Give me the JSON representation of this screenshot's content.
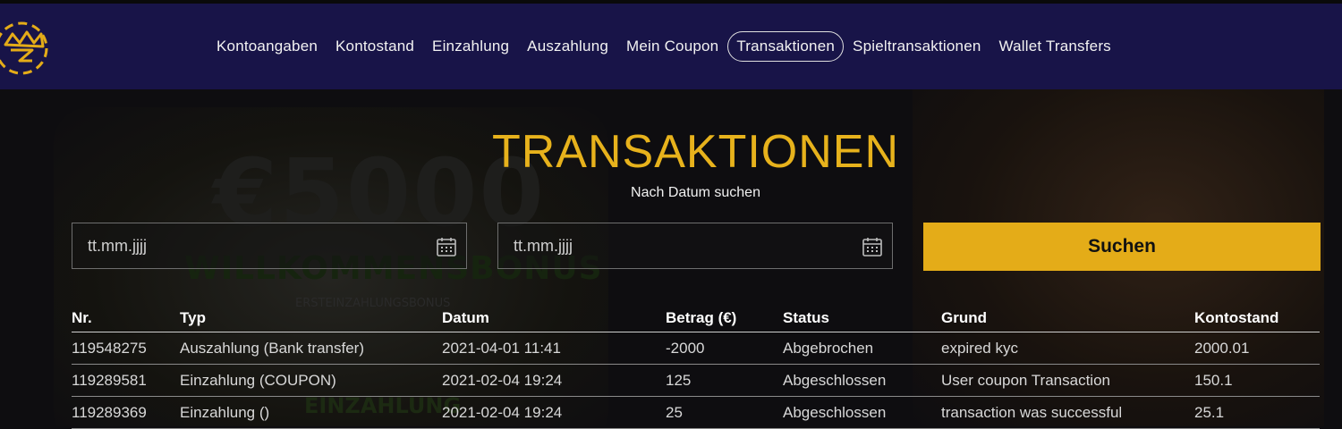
{
  "nav": {
    "items": [
      {
        "label": "Kontoangaben"
      },
      {
        "label": "Kontostand"
      },
      {
        "label": "Einzahlung"
      },
      {
        "label": "Auszahlung"
      },
      {
        "label": "Mein Coupon"
      },
      {
        "label": "Transaktionen",
        "active": true
      },
      {
        "label": "Spieltransaktionen"
      },
      {
        "label": "Wallet Transfers"
      }
    ]
  },
  "background_promo": {
    "amount": "€5000",
    "headline": "WILLKOMMENSBONUS",
    "subline": "ERSTEINZAHLUNGSBONUS",
    "footer": "EINZAHLUNG"
  },
  "page": {
    "title": "TRANSAKTIONEN",
    "subtitle": "Nach Datum suchen"
  },
  "filters": {
    "from_placeholder": "tt.mm.jjjj",
    "to_placeholder": "tt.mm.jjjj",
    "search_label": "Suchen"
  },
  "table": {
    "headers": [
      "Nr.",
      "Typ",
      "Datum",
      "Betrag (€)",
      "Status",
      "Grund",
      "Kontostand"
    ],
    "rows": [
      [
        "119548275",
        "Auszahlung  (Bank transfer)",
        "2021-04-01 11:41",
        "-2000",
        "Abgebrochen",
        "expired kyc",
        "2000.01"
      ],
      [
        "119289581",
        "Einzahlung  (COUPON)",
        "2021-02-04 19:24",
        "125",
        "Abgeschlossen",
        "User coupon Transaction",
        "150.1"
      ],
      [
        "119289369",
        "Einzahlung  ()",
        "2021-02-04 19:24",
        "25",
        "Abgeschlossen",
        "transaction was successful",
        "25.1"
      ]
    ]
  },
  "colors": {
    "nav_bg": "#181448",
    "accent_gold": "#e4ac18",
    "title_gold": "#e7b21c",
    "page_bg": "#0e0d10"
  },
  "icons": {
    "logo": "crown-logo-icon",
    "date_picker": "calendar-icon"
  }
}
